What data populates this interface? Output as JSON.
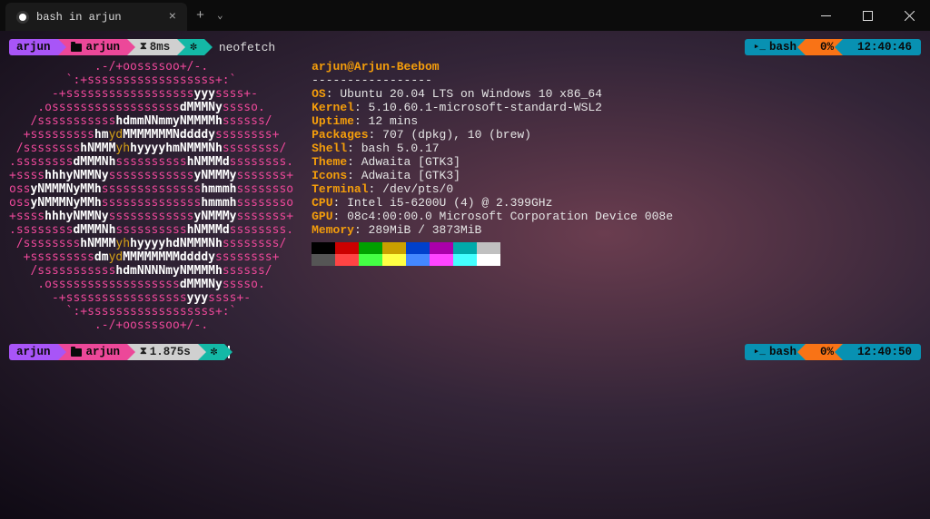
{
  "window": {
    "tab_title": "bash in arjun"
  },
  "prompt1": {
    "user": "arjun",
    "dir": "arjun",
    "exec_time": "8ms",
    "command": "neofetch",
    "right_shell": "bash",
    "right_pct": "0%",
    "right_clock": "12:40:46"
  },
  "neofetch": {
    "user_host": "arjun@Arjun-Beebom",
    "dashes": "-----------------",
    "lines": [
      {
        "k": "OS",
        "v": ": Ubuntu 20.04 LTS on Windows 10 x86_64"
      },
      {
        "k": "Kernel",
        "v": ": 5.10.60.1-microsoft-standard-WSL2"
      },
      {
        "k": "Uptime",
        "v": ": 12 mins"
      },
      {
        "k": "Packages",
        "v": ": 707 (dpkg), 10 (brew)"
      },
      {
        "k": "Shell",
        "v": ": bash 5.0.17"
      },
      {
        "k": "Theme",
        "v": ": Adwaita [GTK3]"
      },
      {
        "k": "Icons",
        "v": ": Adwaita [GTK3]"
      },
      {
        "k": "Terminal",
        "v": ": /dev/pts/0"
      },
      {
        "k": "CPU",
        "v": ": Intel i5-6200U (4) @ 2.399GHz"
      },
      {
        "k": "GPU",
        "v": ": 08c4:00:00.0 Microsoft Corporation Device 008e"
      },
      {
        "k": "Memory",
        "v": ": 289MiB / 3873MiB"
      }
    ],
    "colors_row1": [
      "#000000",
      "#cc0000",
      "#00a000",
      "#caa000",
      "#0040cc",
      "#aa00aa",
      "#00aaaa",
      "#c0c0c0"
    ],
    "colors_row2": [
      "#555555",
      "#ff4444",
      "#44ff44",
      "#ffff44",
      "#4488ff",
      "#ff44ff",
      "#44ffff",
      "#ffffff"
    ]
  },
  "prompt2": {
    "user": "arjun",
    "dir": "arjun",
    "exec_time": "1.875s",
    "right_shell": "bash",
    "right_pct": "0%",
    "right_clock": "12:40:50"
  },
  "logo_lines": [
    [
      {
        "c": "p",
        "t": "            .-/+oossssoo+/-."
      }
    ],
    [
      {
        "c": "p",
        "t": "        `:+ssssssssssssssssss+:`"
      }
    ],
    [
      {
        "c": "p",
        "t": "      -+ssssssssssssssssss"
      },
      {
        "c": "w",
        "t": "yyy"
      },
      {
        "c": "p",
        "t": "ssss+-"
      }
    ],
    [
      {
        "c": "p",
        "t": "    .ossssssssssssssssss"
      },
      {
        "c": "w",
        "t": "dMMMNy"
      },
      {
        "c": "p",
        "t": "sssso."
      }
    ],
    [
      {
        "c": "p",
        "t": "   /sssssssssss"
      },
      {
        "c": "w",
        "t": "hdmmNNmmyNMMMMh"
      },
      {
        "c": "p",
        "t": "ssssss/"
      }
    ],
    [
      {
        "c": "p",
        "t": "  +sssssssss"
      },
      {
        "c": "w",
        "t": "hm"
      },
      {
        "c": "g",
        "t": "yd"
      },
      {
        "c": "w",
        "t": "MMMMMMMNddddy"
      },
      {
        "c": "p",
        "t": "ssssssss+"
      }
    ],
    [
      {
        "c": "p",
        "t": " /ssssssss"
      },
      {
        "c": "w",
        "t": "hNMMM"
      },
      {
        "c": "g",
        "t": "yh"
      },
      {
        "c": "w",
        "t": "hyyyyhmNMMMNh"
      },
      {
        "c": "p",
        "t": "ssssssss/"
      }
    ],
    [
      {
        "c": "p",
        "t": ".ssssssss"
      },
      {
        "c": "w",
        "t": "dMMMNh"
      },
      {
        "c": "p",
        "t": "ssssssssss"
      },
      {
        "c": "w",
        "t": "hNMMMd"
      },
      {
        "c": "p",
        "t": "ssssssss."
      }
    ],
    [
      {
        "c": "p",
        "t": "+ssss"
      },
      {
        "c": "w",
        "t": "hhhyNMMNy"
      },
      {
        "c": "p",
        "t": "ssssssssssss"
      },
      {
        "c": "w",
        "t": "yNMMMy"
      },
      {
        "c": "p",
        "t": "sssssss+"
      }
    ],
    [
      {
        "c": "p",
        "t": "oss"
      },
      {
        "c": "w",
        "t": "yNMMMNyMMh"
      },
      {
        "c": "p",
        "t": "ssssssssssssss"
      },
      {
        "c": "w",
        "t": "hmmmh"
      },
      {
        "c": "p",
        "t": "ssssssso"
      }
    ],
    [
      {
        "c": "p",
        "t": "oss"
      },
      {
        "c": "w",
        "t": "yNMMMNyMMh"
      },
      {
        "c": "p",
        "t": "ssssssssssssss"
      },
      {
        "c": "w",
        "t": "hmmmh"
      },
      {
        "c": "p",
        "t": "ssssssso"
      }
    ],
    [
      {
        "c": "p",
        "t": "+ssss"
      },
      {
        "c": "w",
        "t": "hhhyNMMNy"
      },
      {
        "c": "p",
        "t": "ssssssssssss"
      },
      {
        "c": "w",
        "t": "yNMMMy"
      },
      {
        "c": "p",
        "t": "sssssss+"
      }
    ],
    [
      {
        "c": "p",
        "t": ".ssssssss"
      },
      {
        "c": "w",
        "t": "dMMMNh"
      },
      {
        "c": "p",
        "t": "ssssssssss"
      },
      {
        "c": "w",
        "t": "hNMMMd"
      },
      {
        "c": "p",
        "t": "ssssssss."
      }
    ],
    [
      {
        "c": "p",
        "t": " /ssssssss"
      },
      {
        "c": "w",
        "t": "hNMMM"
      },
      {
        "c": "g",
        "t": "yh"
      },
      {
        "c": "w",
        "t": "hyyyyhdNMMMNh"
      },
      {
        "c": "p",
        "t": "ssssssss/"
      }
    ],
    [
      {
        "c": "p",
        "t": "  +sssssssss"
      },
      {
        "c": "w",
        "t": "dm"
      },
      {
        "c": "g",
        "t": "yd"
      },
      {
        "c": "w",
        "t": "MMMMMMMMddddy"
      },
      {
        "c": "p",
        "t": "ssssssss+"
      }
    ],
    [
      {
        "c": "p",
        "t": "   /sssssssssss"
      },
      {
        "c": "w",
        "t": "hdmNNNNmyNMMMMh"
      },
      {
        "c": "p",
        "t": "ssssss/"
      }
    ],
    [
      {
        "c": "p",
        "t": "    .ossssssssssssssssss"
      },
      {
        "c": "w",
        "t": "dMMMNy"
      },
      {
        "c": "p",
        "t": "sssso."
      }
    ],
    [
      {
        "c": "p",
        "t": "      -+sssssssssssssssss"
      },
      {
        "c": "w",
        "t": "yyy"
      },
      {
        "c": "p",
        "t": "ssss+-"
      }
    ],
    [
      {
        "c": "p",
        "t": "        `:+ssssssssssssssssss+:`"
      }
    ],
    [
      {
        "c": "p",
        "t": "            .-/+oossssoo+/-."
      }
    ]
  ]
}
